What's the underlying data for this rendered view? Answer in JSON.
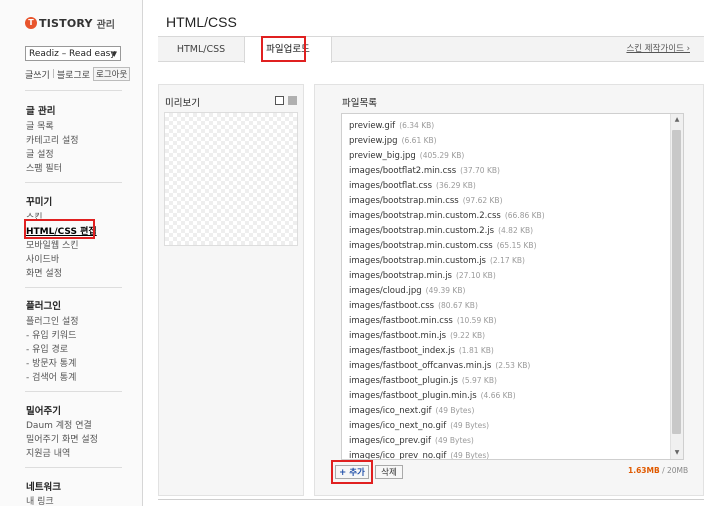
{
  "brand": {
    "name": "TISTORY",
    "sub": "관리",
    "logo_letter": "T",
    "logo_color": "#e8542c"
  },
  "sidebar": {
    "blog_select": "Readiz – Read easy",
    "links": {
      "write": "글쓰기",
      "blog_home": "블로그로",
      "logout": "로그아웃"
    },
    "sections": [
      {
        "title": "글 관리",
        "items": [
          "글 목록",
          "카테고리 설정",
          "글 설정",
          "스팸 필터"
        ]
      },
      {
        "title": "꾸미기",
        "items": [
          "스킨",
          "HTML/CSS 편집",
          "모바일웹 스킨",
          "사이드바",
          "화면 설정"
        ]
      },
      {
        "title": "플러그인",
        "items": [
          "플러그인 설정",
          "- 유입 키워드",
          "- 유입 경로",
          "- 방문자 통계",
          "- 검색어 통계"
        ]
      },
      {
        "title": "밀어주기",
        "items": [
          "Daum 계정 연결",
          "밀어주기 화면 설정",
          "지원금 내역"
        ]
      },
      {
        "title": "네트워크",
        "items": [
          "내 링크"
        ]
      }
    ],
    "active_item": "HTML/CSS 편집"
  },
  "main": {
    "title": "HTML/CSS",
    "tabs": [
      {
        "label": "HTML/CSS",
        "active": false
      },
      {
        "label": "파일업로드",
        "active": true
      }
    ],
    "guide_link": "스킨 제작가이드 ›",
    "preview": {
      "label": "미리보기"
    },
    "files": {
      "label": "파일목록",
      "items": [
        {
          "name": "preview.gif",
          "size": "(6.34 KB)"
        },
        {
          "name": "preview.jpg",
          "size": "(6.61 KB)"
        },
        {
          "name": "preview_big.jpg",
          "size": "(405.29 KB)"
        },
        {
          "name": "images/bootflat2.min.css",
          "size": "(37.70 KB)"
        },
        {
          "name": "images/bootflat.css",
          "size": "(36.29 KB)"
        },
        {
          "name": "images/bootstrap.min.css",
          "size": "(97.62 KB)"
        },
        {
          "name": "images/bootstrap.min.custom.2.css",
          "size": "(66.86 KB)"
        },
        {
          "name": "images/bootstrap.min.custom.2.js",
          "size": "(4.82 KB)"
        },
        {
          "name": "images/bootstrap.min.custom.css",
          "size": "(65.15 KB)"
        },
        {
          "name": "images/bootstrap.min.custom.js",
          "size": "(2.17 KB)"
        },
        {
          "name": "images/bootstrap.min.js",
          "size": "(27.10 KB)"
        },
        {
          "name": "images/cloud.jpg",
          "size": "(49.39 KB)"
        },
        {
          "name": "images/fastboot.css",
          "size": "(80.67 KB)"
        },
        {
          "name": "images/fastboot.min.css",
          "size": "(10.59 KB)"
        },
        {
          "name": "images/fastboot.min.js",
          "size": "(9.22 KB)"
        },
        {
          "name": "images/fastboot_index.js",
          "size": "(1.81 KB)"
        },
        {
          "name": "images/fastboot_offcanvas.min.js",
          "size": "(2.53 KB)"
        },
        {
          "name": "images/fastboot_plugin.js",
          "size": "(5.97 KB)"
        },
        {
          "name": "images/fastboot_plugin.min.js",
          "size": "(4.66 KB)"
        },
        {
          "name": "images/ico_next.gif",
          "size": "(49 Bytes)"
        },
        {
          "name": "images/ico_next_no.gif",
          "size": "(49 Bytes)"
        },
        {
          "name": "images/ico_prev.gif",
          "size": "(49 Bytes)"
        },
        {
          "name": "images/ico_prev_no.gif",
          "size": "(49 Bytes)"
        }
      ]
    },
    "buttons": {
      "add": "+ 추가",
      "delete": "삭제"
    },
    "usage": {
      "used": "1.63MB",
      "total": " / 20MB"
    }
  },
  "colors": {
    "highlight_box": "#e02020",
    "usage_used": "#e05a00",
    "add_button_text": "#1f4ea8"
  }
}
